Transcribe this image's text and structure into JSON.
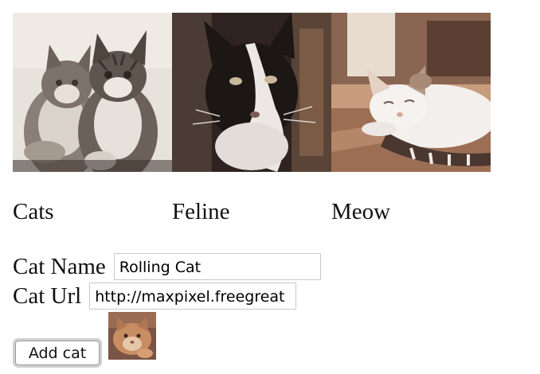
{
  "gallery": {
    "tiles": [
      {
        "image_icon": "kittens-photo-icon",
        "caption": "Cats"
      },
      {
        "image_icon": "black-white-cat-photo-icon",
        "caption": "Feline"
      },
      {
        "image_icon": "resting-cat-photo-icon",
        "caption": "Meow"
      }
    ]
  },
  "form": {
    "name_label": "Cat Name",
    "name_value": "Rolling Cat",
    "url_label": "Cat Url",
    "url_value": "http://maxpixel.freegreat",
    "submit_label": "Add cat",
    "preview_icon": "cat-preview-thumbnail-icon"
  },
  "colors": {
    "input_border": "#c9c9c9",
    "button_border": "#cfcfcf",
    "text": "#111111"
  }
}
